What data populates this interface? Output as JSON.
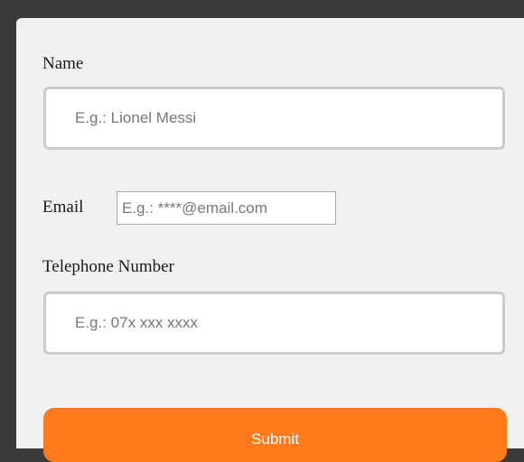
{
  "form": {
    "name": {
      "label": "Name",
      "placeholder": "E.g.: Lionel Messi"
    },
    "email": {
      "label": "Email",
      "placeholder": "E.g.: ****@email.com"
    },
    "telephone": {
      "label": "Telephone Number",
      "placeholder": "E.g.: 07x xxx xxxx"
    },
    "submit_label": "Submit",
    "colors": {
      "accent": "#ff7a1a",
      "panel": "#f1f1f1",
      "frame": "#3a3a3a"
    }
  }
}
